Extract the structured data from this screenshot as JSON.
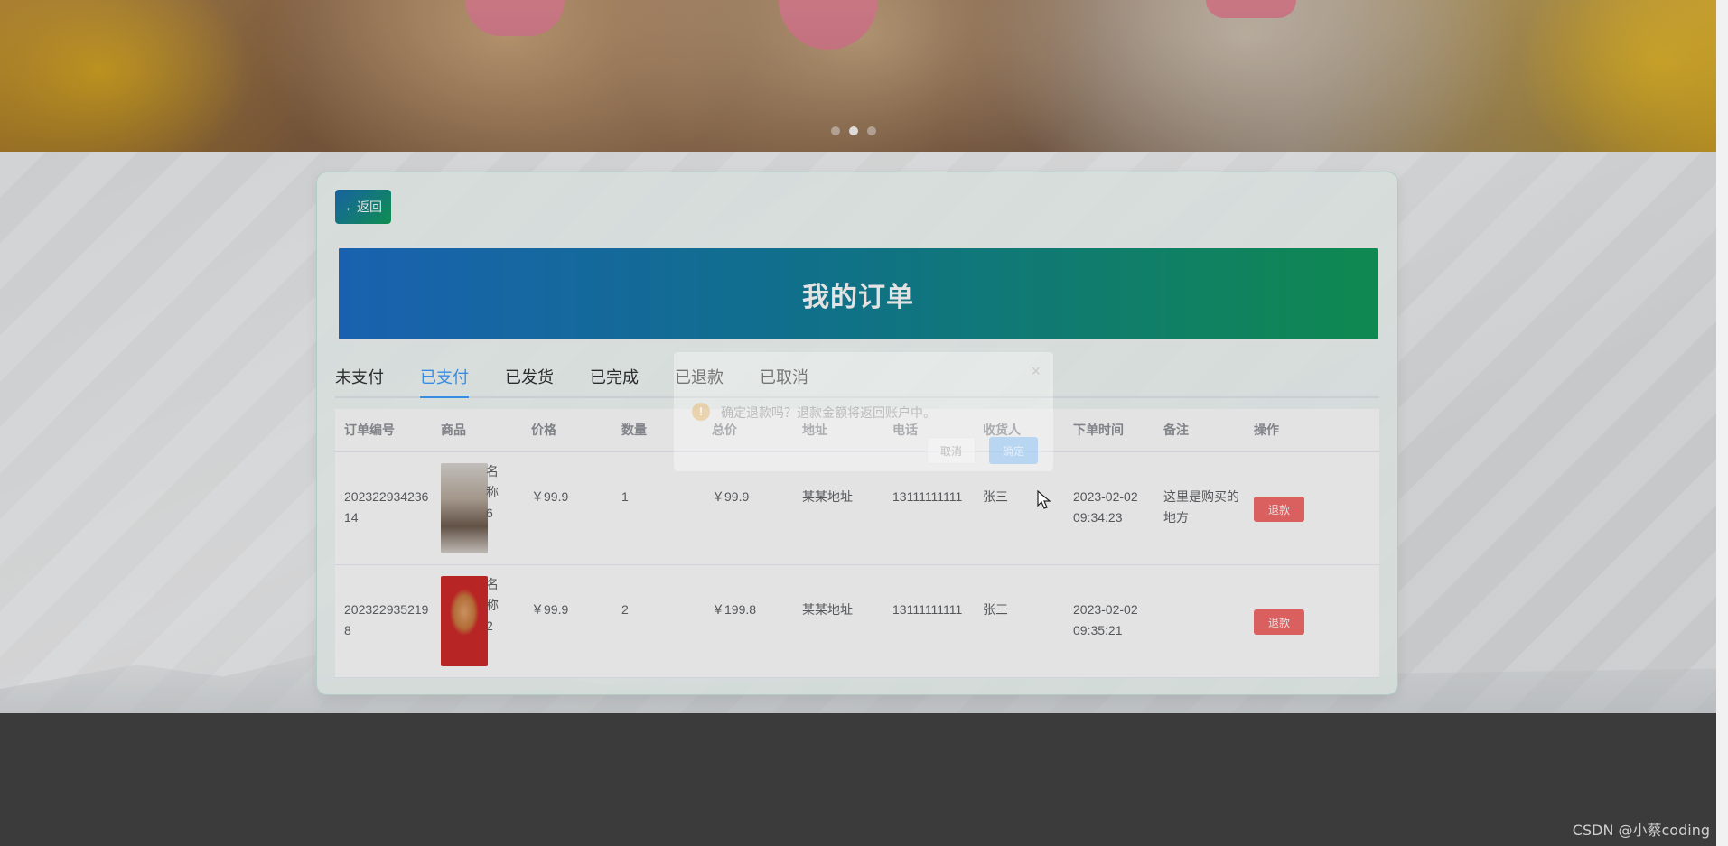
{
  "banner": {
    "dots_count": 3,
    "active_dot": 1
  },
  "card": {
    "back_label": "←返回",
    "title": "我的订单"
  },
  "tabs": [
    {
      "label": "未支付",
      "active": false
    },
    {
      "label": "已支付",
      "active": true
    },
    {
      "label": "已发货",
      "active": false
    },
    {
      "label": "已完成",
      "active": false
    },
    {
      "label": "已退款",
      "active": false
    },
    {
      "label": "已取消",
      "active": false
    }
  ],
  "table": {
    "columns": [
      "订单编号",
      "商品",
      "价格",
      "数量",
      "总价",
      "地址",
      "电话",
      "收货人",
      "下单时间",
      "备注",
      "操作"
    ],
    "rows": [
      {
        "order_id": "20232293423614",
        "product_name": "名称6",
        "product_image": "cat-with-bowtie",
        "price": "￥99.9",
        "quantity": "1",
        "total": "￥99.9",
        "address": "某某地址",
        "phone": "13111111111",
        "receiver": "张三",
        "time": "2023-02-02 09:34:23",
        "note": "这里是购买的地方",
        "action": "退款"
      },
      {
        "order_id": "2023229352198",
        "product_name": "名称2",
        "product_image": "dog-on-red",
        "price": "￥99.9",
        "quantity": "2",
        "total": "￥199.8",
        "address": "某某地址",
        "phone": "13111111111",
        "receiver": "张三",
        "time": "2023-02-02 09:35:21",
        "note": "",
        "action": "退款"
      }
    ]
  },
  "dialog": {
    "close_icon": "×",
    "warning_icon": "!",
    "message": "确定退款吗？退款金额将返回账户中。",
    "cancel_label": "取消",
    "confirm_label": "确定"
  },
  "watermark": "CSDN @小蔡coding",
  "colors": {
    "accent": "#409eff",
    "danger": "#f56c6c",
    "title_gradient_start": "#1c6ec6",
    "title_gradient_end": "#119a5a",
    "footer": "#3b3b3b"
  }
}
